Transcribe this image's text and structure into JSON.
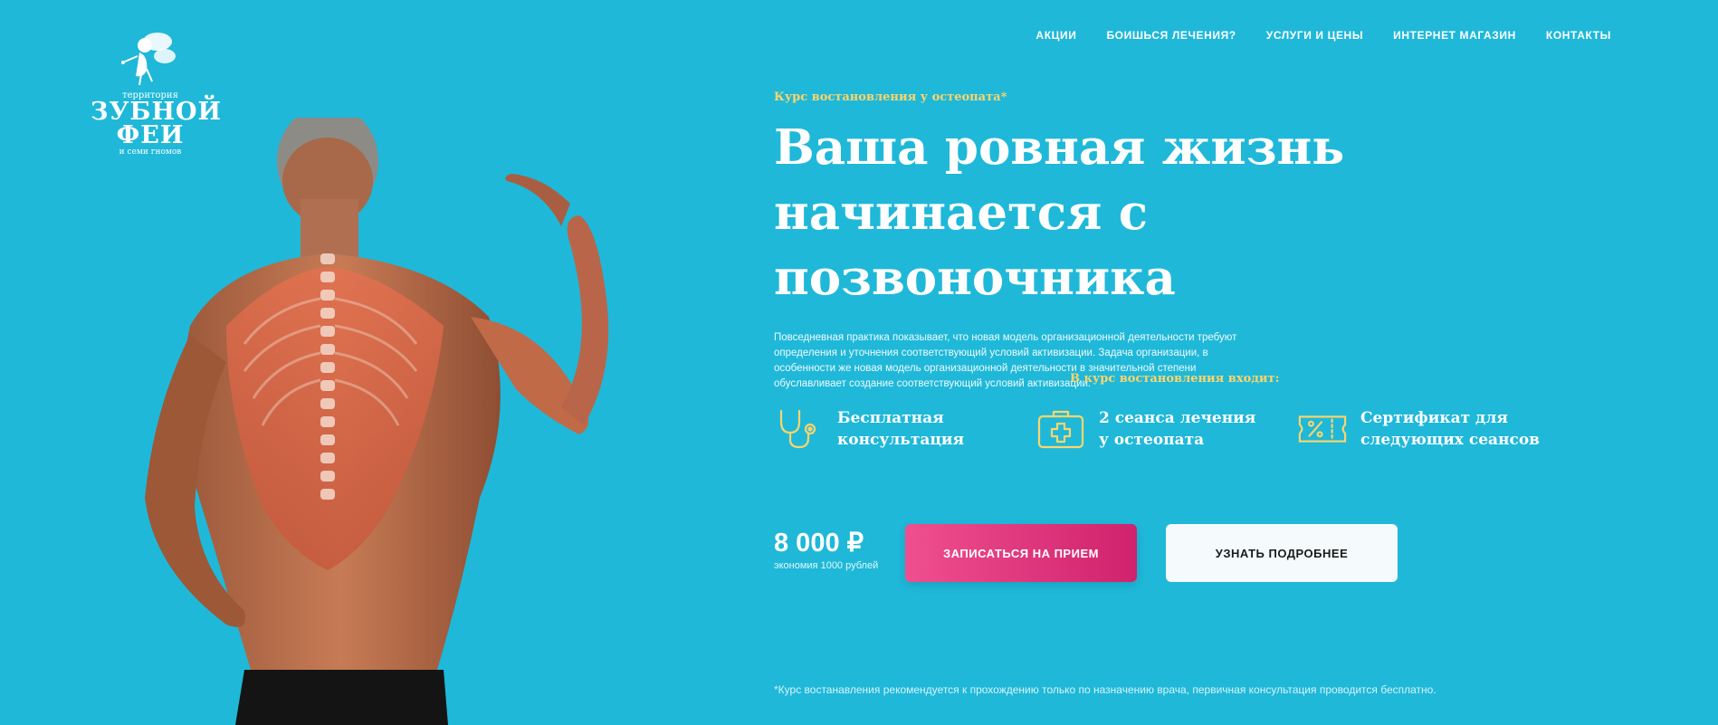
{
  "brand": {
    "line1": "территория",
    "line2": "ЗУБНОЙ ФЕИ",
    "line3": "и семи гномов"
  },
  "nav": {
    "items": [
      {
        "label": "АКЦИИ"
      },
      {
        "label": "БОИШЬСЯ ЛЕЧЕНИЯ?"
      },
      {
        "label": "УСЛУГИ И ЦЕНЫ"
      },
      {
        "label": "ИНТЕРНЕТ МАГАЗИН"
      },
      {
        "label": "КОНТАКТЫ"
      }
    ]
  },
  "hero": {
    "kicker": "Курс востановления у остеопата*",
    "headline_line1": "Ваша ровная жизнь",
    "headline_line2": "начинается с позвоночника",
    "description": "Повседневная практика показывает, что новая модель организационной деятельности требуют определения и уточнения соответствующий условий активизации. Задача организации, в особенности же новая модель организационной деятельности в значительной степени обуславливает создание соответствующий условий активизации.",
    "includes_title": "В курс востановления входит:",
    "features": [
      {
        "icon": "stethoscope-icon",
        "line1": "Бесплатная",
        "line2": "консультация"
      },
      {
        "icon": "first-aid-kit-icon",
        "line1": "2 сеанса лечения",
        "line2": "у остеопата"
      },
      {
        "icon": "discount-ticket-icon",
        "line1": "Сертификат для",
        "line2": "следующих сеансов"
      }
    ],
    "price": "8 000 ₽",
    "price_note": "экономия 1000 рублей",
    "primary_button": "ЗАПИСАТЬСЯ НА ПРИЕМ",
    "secondary_button": "УЗНАТЬ ПОДРОБНЕЕ",
    "footnote": "*Курс востанавления рекомендуется к прохождению только по назначению врача, первичная консультация проводится бесплатно."
  },
  "colors": {
    "background": "#1fb8d9",
    "accent_yellow": "#ffd56b",
    "primary_button": "#e23d80",
    "secondary_button": "#f5fbfd"
  }
}
